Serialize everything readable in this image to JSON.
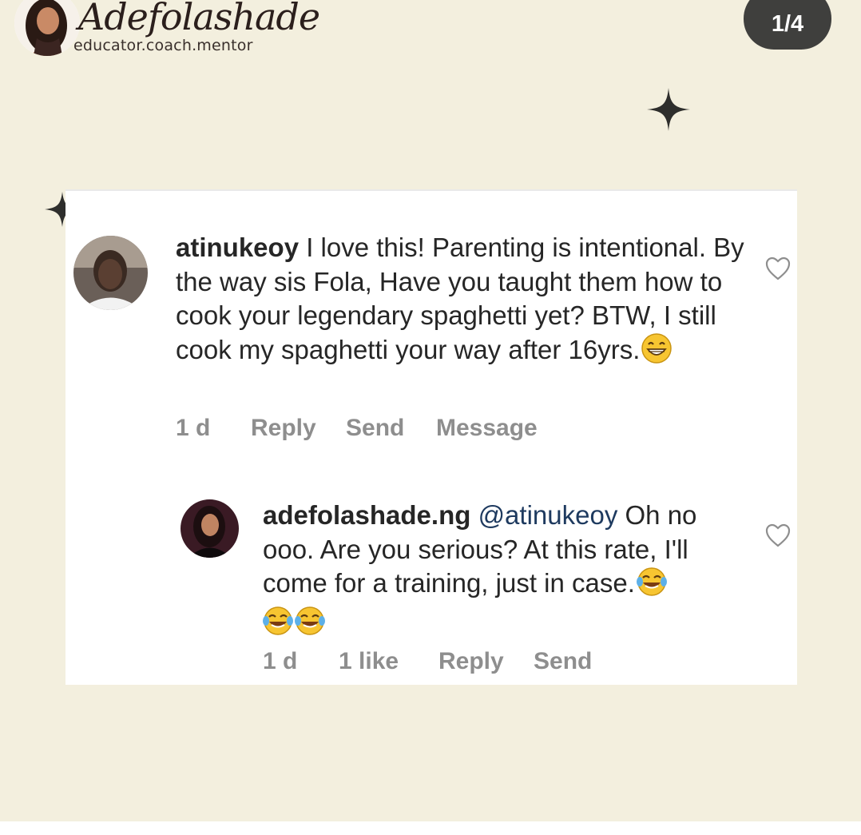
{
  "brand": {
    "script_name": "Adefolashade",
    "tagline": "educator.coach.mentor"
  },
  "page_indicator": "1/4",
  "comments": [
    {
      "username": "atinukeoy",
      "text_before": "I love this! Parenting is intentional. By the way sis Fola, Have you taught them how to cook your legendary spaghetti yet? BTW, I still cook my spaghetti your way after 16yrs.",
      "emojis": [
        "grinning-face"
      ],
      "time": "1 d",
      "actions": [
        "Reply",
        "Send",
        "Message"
      ]
    },
    {
      "username": "adefolashade.ng",
      "mention": "@atinukeoy",
      "text_before": "Oh no ooo. Are you serious? At this rate, I'll come for a training, just in case.",
      "emojis": [
        "tears-of-joy",
        "tears-of-joy",
        "tears-of-joy"
      ],
      "time": "1 d",
      "likes": "1 like",
      "actions": [
        "Reply",
        "Send"
      ]
    }
  ],
  "colors": {
    "background": "#f3efde",
    "card": "#ffffff",
    "text": "#262626",
    "meta": "#8e8e8e",
    "mention": "#1e3a5f",
    "indicator": "#3f3f3d"
  },
  "icons": [
    "heart-icon",
    "sparkle-icon",
    "grinning-face-emoji",
    "tears-of-joy-emoji"
  ]
}
